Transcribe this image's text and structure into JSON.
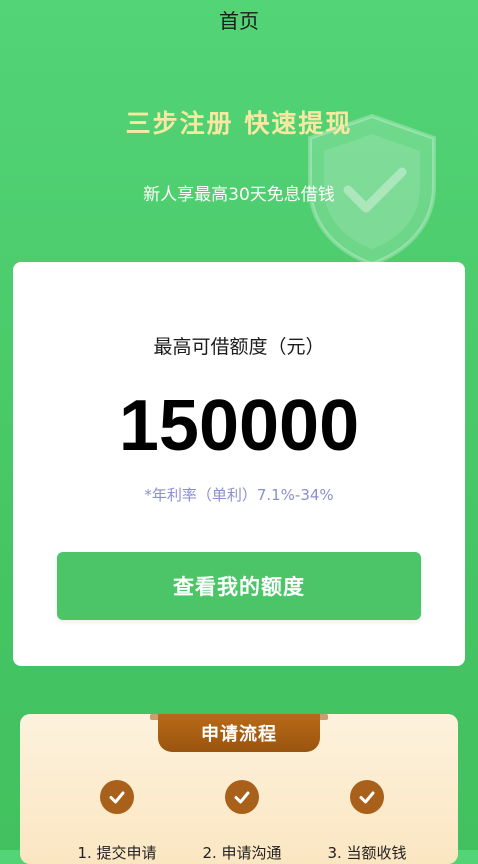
{
  "nav": {
    "title": "首页"
  },
  "hero": {
    "title": "三步注册 快速提现",
    "subtitle": "新人享最高30天免息借钱"
  },
  "loan_card": {
    "label": "最高可借额度（元）",
    "amount": "150000",
    "rate_note": "*年利率（单利）7.1%-34%",
    "cta_label": "查看我的额度"
  },
  "process": {
    "title": "申请流程",
    "steps": [
      {
        "label": "1. 提交申请"
      },
      {
        "label": "2. 申请沟通"
      },
      {
        "label": "3. 当额收钱"
      }
    ]
  },
  "colors": {
    "primary_green": "#4cc569",
    "hero_title": "#f8e9a2",
    "rate_text": "#8c8ed0",
    "process_brown": "#a8601a"
  },
  "icons": {
    "shield": "shield-check-icon",
    "step": "check-circle-icon"
  }
}
